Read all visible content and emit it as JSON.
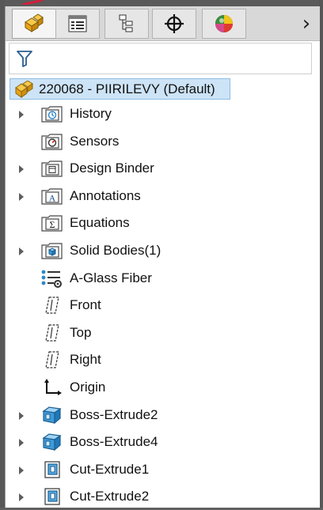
{
  "tabs": [
    {
      "name": "featuremanager-tab",
      "icon": "part-cubes-icon",
      "active": true
    },
    {
      "name": "propertymanager-tab",
      "icon": "property-list-icon",
      "active": false
    },
    {
      "name": "configurationmanager-tab",
      "icon": "configuration-tree-icon",
      "active": false
    },
    {
      "name": "dimxpert-tab",
      "icon": "crosshair-icon",
      "active": false
    },
    {
      "name": "appearance-tab",
      "icon": "color-ball-icon",
      "active": false
    }
  ],
  "more_glyph": "›",
  "filter": {
    "icon": "filter-funnel-icon"
  },
  "root": {
    "label": "220068 - PIIRILEVY  (Default)",
    "icon": "part-icon"
  },
  "tree": [
    {
      "label": "History",
      "icon": "history-folder-icon",
      "expandable": true
    },
    {
      "label": "Sensors",
      "icon": "sensors-folder-icon",
      "expandable": false
    },
    {
      "label": "Design Binder",
      "icon": "design-binder-folder-icon",
      "expandable": true
    },
    {
      "label": "Annotations",
      "icon": "annotations-folder-icon",
      "expandable": true
    },
    {
      "label": "Equations",
      "icon": "equations-folder-icon",
      "expandable": false
    },
    {
      "label": "Solid Bodies(1)",
      "icon": "solid-bodies-folder-icon",
      "expandable": true
    },
    {
      "label": "A-Glass Fiber",
      "icon": "material-icon",
      "expandable": false
    },
    {
      "label": "Front",
      "icon": "plane-icon",
      "expandable": false
    },
    {
      "label": "Top",
      "icon": "plane-icon",
      "expandable": false
    },
    {
      "label": "Right",
      "icon": "plane-icon",
      "expandable": false
    },
    {
      "label": "Origin",
      "icon": "origin-icon",
      "expandable": false
    },
    {
      "label": "Boss-Extrude2",
      "icon": "boss-extrude-icon",
      "expandable": true
    },
    {
      "label": "Boss-Extrude4",
      "icon": "boss-extrude-icon",
      "expandable": true
    },
    {
      "label": "Cut-Extrude1",
      "icon": "cut-extrude-icon",
      "expandable": true
    },
    {
      "label": "Cut-Extrude2",
      "icon": "cut-extrude-icon",
      "expandable": true
    }
  ],
  "colors": {
    "selection_fill": "#cde3f6",
    "selection_border": "#8fbde4",
    "part_icon_yellow": "#f2b41c",
    "feature_icon_blue": "#2f86c9"
  }
}
